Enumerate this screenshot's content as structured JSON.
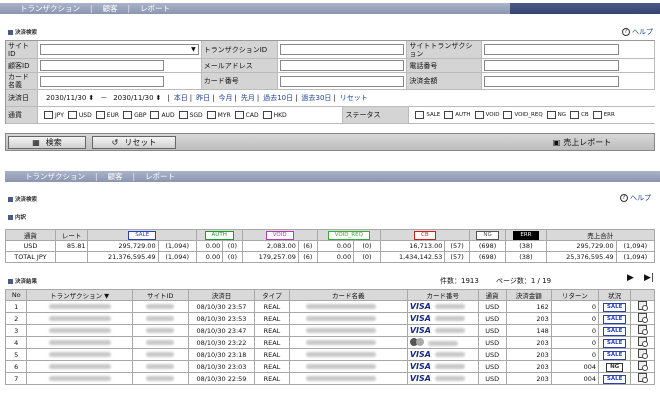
{
  "nav1": {
    "items": [
      "トランザクション",
      "顧客",
      "レポート"
    ]
  },
  "nav2": {
    "items": [
      "トランザクション",
      "顧客",
      "レポート"
    ]
  },
  "help_label": "ヘルプ",
  "search": {
    "title": "決済検索",
    "site_id": "サイトID",
    "transaction_id": "トランザクションID",
    "site_transaction": "サイトトランザクション",
    "customer_id": "顧客ID",
    "email": "メールアドレス",
    "phone": "電話番号",
    "card_name": "カード名義",
    "card_number": "カード番号",
    "amount": "決済金額",
    "date_label": "決済日",
    "date_from": "2030/11/30",
    "date_to": "2030/11/30",
    "dash": "－",
    "date_links": [
      "本日",
      "昨日",
      "今月",
      "先月",
      "過去10日",
      "過去30日",
      "リセット"
    ],
    "currency_label": "通貨",
    "currencies": [
      "JPY",
      "USD",
      "EUR",
      "GBP",
      "AUD",
      "SGD",
      "MYR",
      "CAD",
      "HKD"
    ],
    "status_label": "ステータス",
    "statuses": [
      "SALE",
      "AUTH",
      "VOID",
      "VOID_REQ",
      "NG",
      "CB",
      "ERR"
    ]
  },
  "buttons": {
    "search": "検索",
    "reset": "リセット",
    "report": "売上レポート"
  },
  "result": {
    "title": "決済検索",
    "detail_title": "内訳",
    "list_title": "決済結果",
    "count_label": "件数：1913",
    "page_label": "ページ数：1 / 19"
  },
  "summary": {
    "headers": [
      "通貨",
      "レート",
      "SALE",
      "AUTH",
      "VOID",
      "VOID_REQ",
      "CB",
      "NG",
      "ERR",
      "売上合計"
    ],
    "rows": [
      {
        "cur": "USD",
        "rate": "85.81",
        "sale": "295,729.00",
        "sale_n": "(1,094)",
        "auth": "0.00",
        "auth_n": "(0)",
        "void": "2,083.00",
        "void_n": "(6)",
        "vreq": "0.00",
        "vreq_n": "(0)",
        "cb": "16,713.00",
        "cb_n": "(57)",
        "ng": "(698)",
        "err": "(38)",
        "total": "295,729.00",
        "total_n": "(1,094)"
      },
      {
        "cur": "TOTAL JPY",
        "rate": "",
        "sale": "21,376,595.49",
        "sale_n": "(1,094)",
        "auth": "0.00",
        "auth_n": "(0)",
        "void": "179,257.09",
        "void_n": "(6)",
        "vreq": "0.00",
        "vreq_n": "(0)",
        "cb": "1,434,142.53",
        "cb_n": "(57)",
        "ng": "(698)",
        "err": "(38)",
        "total": "25,376,595.49",
        "total_n": "(1,094)"
      }
    ]
  },
  "list": {
    "headers": [
      "No",
      "トランザクション",
      "サイトID",
      "決済日",
      "タイプ",
      "カード名義",
      "カード番号",
      "通貨",
      "決済金額",
      "リターン",
      "状況",
      ""
    ],
    "rows": [
      {
        "no": "1",
        "date": "08/10/30 23:57",
        "type": "REAL",
        "brand": "VISA",
        "cur": "USD",
        "amt": "162",
        "ret": "0",
        "status": "SALE"
      },
      {
        "no": "2",
        "date": "08/10/30 23:53",
        "type": "REAL",
        "brand": "VISA",
        "cur": "USD",
        "amt": "203",
        "ret": "0",
        "status": "SALE"
      },
      {
        "no": "3",
        "date": "08/10/30 23:47",
        "type": "REAL",
        "brand": "VISA",
        "cur": "USD",
        "amt": "148",
        "ret": "0",
        "status": "SALE"
      },
      {
        "no": "4",
        "date": "08/10/30 23:22",
        "type": "REAL",
        "brand": "MC",
        "cur": "USD",
        "amt": "203",
        "ret": "0",
        "status": "SALE"
      },
      {
        "no": "5",
        "date": "08/10/30 23:18",
        "type": "REAL",
        "brand": "VISA",
        "cur": "USD",
        "amt": "203",
        "ret": "0",
        "status": "SALE"
      },
      {
        "no": "6",
        "date": "08/10/30 23:03",
        "type": "REAL",
        "brand": "VISA",
        "cur": "USD",
        "amt": "203",
        "ret": "004",
        "status": "NG"
      },
      {
        "no": "7",
        "date": "08/10/30 22:59",
        "type": "REAL",
        "brand": "VISA",
        "cur": "USD",
        "amt": "203",
        "ret": "004",
        "status": "SALE"
      }
    ]
  },
  "colors": {
    "nav": "#8a96b1",
    "nav_dark": "#344271",
    "label_bg": "#d4d4d4",
    "status_blue": "#2a3fb8",
    "sale": "#2a3fb8",
    "auth": "#1a9a2a",
    "void": "#b040b0",
    "vreq": "#3aa83a",
    "cb": "#cc2020",
    "ng": "#555555",
    "err": "#000000"
  },
  "icons": [
    "help-icon",
    "search-icon",
    "reset-icon",
    "report-icon",
    "detail-icon",
    "next-page-icon",
    "last-page-icon"
  ]
}
